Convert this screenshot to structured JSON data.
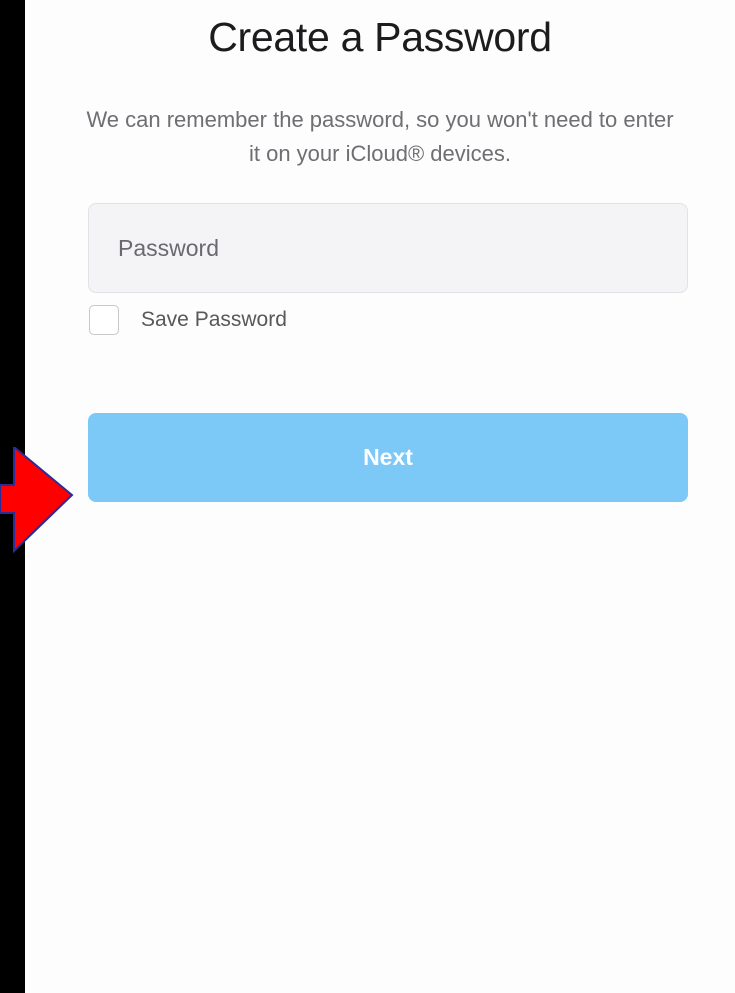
{
  "screen": {
    "title": "Create a Password",
    "subtitle": "We can remember the password, so you won't need to enter it on your iCloud® devices."
  },
  "form": {
    "password_placeholder": "Password",
    "password_value": "",
    "save_password_label": "Save Password",
    "save_password_checked": false,
    "next_label": "Next"
  },
  "annotation": {
    "arrow_icon": "red-arrow-right-icon",
    "arrow_color": "#ff0000"
  },
  "colors": {
    "button": "#7cc8f7",
    "field_background": "#f4f4f6"
  }
}
